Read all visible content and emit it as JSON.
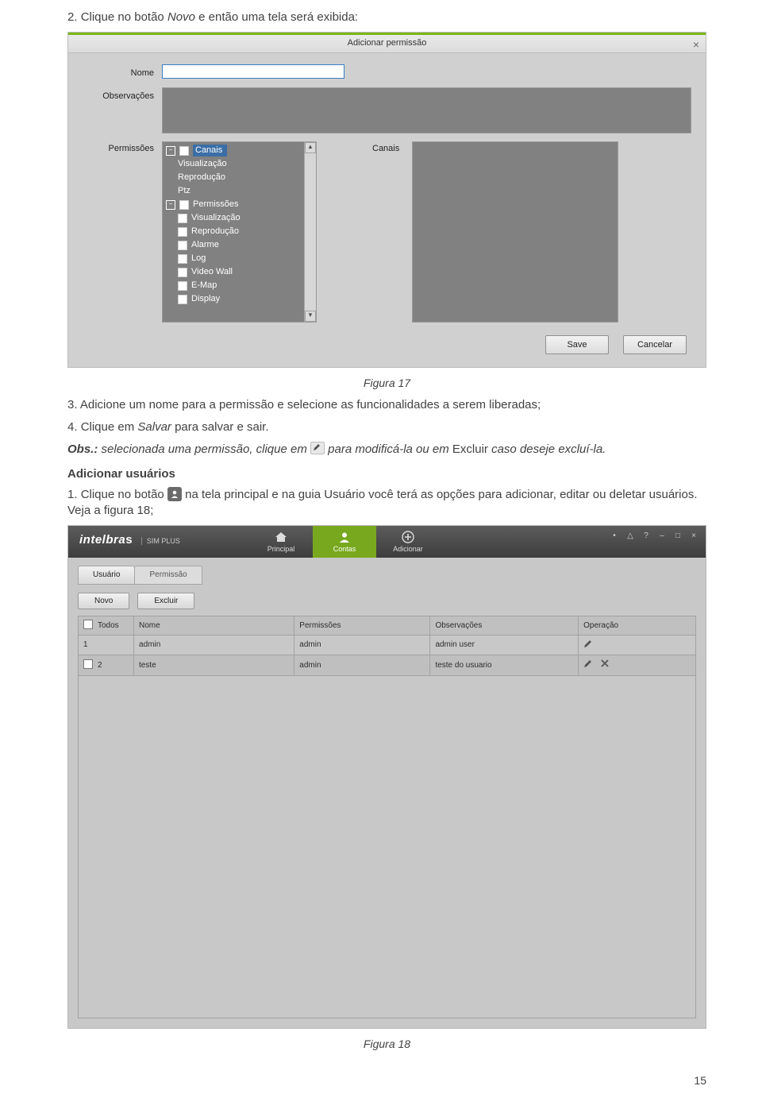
{
  "doc": {
    "step2_num": "2. ",
    "step2_a": "Clique no botão ",
    "step2_novo": "Novo",
    "step2_b": " e então uma tela será exibida:",
    "fig17_caption": "Figura 17",
    "step3_num": "3. ",
    "step3_txt": "Adicione um nome para a permissão e selecione as funcionalidades a serem liberadas;",
    "step4_num": "4. ",
    "step4_a": "Clique em ",
    "step4_salvar": "Salvar",
    "step4_b": " para salvar e sair.",
    "obs_lbl": "Obs.:",
    "obs_a": " selecionada uma permissão, clique em ",
    "obs_b": " para modificá-la ou em ",
    "obs_exc": "Excluir",
    "obs_c": " caso deseje excluí-la.",
    "h4": "Adicionar usuários",
    "au_num": "1. ",
    "au_a": "Clique no botão ",
    "au_b": " na tela principal e na guia Usuário você terá as opções para adicionar, editar ou deletar usuários. Veja a figura 18;",
    "fig18_caption": "Figura 18",
    "page_num": "15"
  },
  "fig17": {
    "title": "Adicionar permissão",
    "labels": {
      "nome": "Nome",
      "obs": "Observações",
      "perm": "Permissões",
      "canais": "Canais"
    },
    "tree": {
      "canais": "Canais",
      "vis": "Visualização",
      "rep": "Reprodução",
      "ptz": "Ptz",
      "perm": "Permissões",
      "p_vis": "Visualização",
      "p_rep": "Reprodução",
      "p_alarme": "Alarme",
      "p_log": "Log",
      "p_vw": "Video Wall",
      "p_emap": "E-Map",
      "p_disp": "Display"
    },
    "buttons": {
      "save": "Save",
      "cancel": "Cancelar"
    }
  },
  "fig18": {
    "brand1": "intelbra",
    "brand1b": "s",
    "brand2": "SIM PLUS",
    "tab_principal": "Principal",
    "tab_contas": "Contas",
    "tab_adicionar": "Adicionar",
    "win_icons": {
      "user": "•",
      "lock": "△",
      "help": "?",
      "min": "–",
      "max": "□",
      "close": "×"
    },
    "sub_usuario": "Usuário",
    "sub_permissao": "Permissão",
    "btn_novo": "Novo",
    "btn_excluir": "Excluir",
    "headers": {
      "todos": "Todos",
      "nome": "Nome",
      "perm": "Permissões",
      "obs": "Observações",
      "op": "Operação"
    },
    "rows": [
      {
        "idx": "1",
        "nome": "admin",
        "perm": "admin",
        "obs": "admin user",
        "ops": [
          "edit"
        ]
      },
      {
        "idx": "2",
        "nome": "teste",
        "perm": "admin",
        "obs": "teste do usuario",
        "ops": [
          "edit",
          "del"
        ]
      }
    ]
  }
}
